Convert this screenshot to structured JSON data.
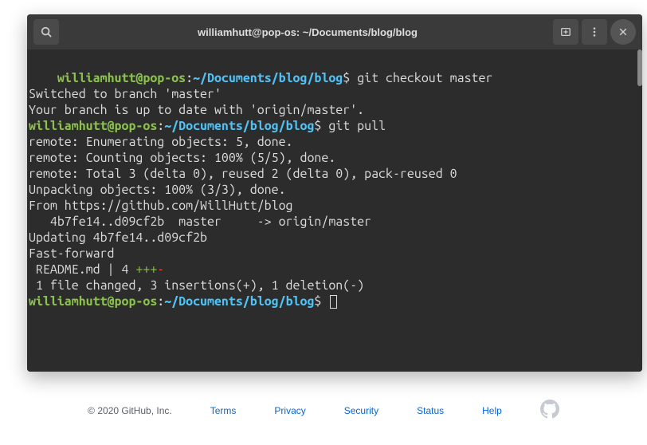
{
  "titlebar": {
    "title": "williamhutt@pop-os: ~/Documents/blog/blog"
  },
  "prompt": {
    "user": "williamhutt@pop-os",
    "colon": ":",
    "path": "~/Documents/blog/blog",
    "dollar": "$ "
  },
  "lines": {
    "cmd1": "git checkout master",
    "out1": "Switched to branch 'master'",
    "out2": "Your branch is up to date with 'origin/master'.",
    "cmd2": "git pull",
    "out3": "remote: Enumerating objects: 5, done.",
    "out4": "remote: Counting objects: 100% (5/5), done.",
    "out5": "remote: Total 3 (delta 0), reused 2 (delta 0), pack-reused 0",
    "out6": "Unpacking objects: 100% (3/3), done.",
    "out7": "From https://github.com/WillHutt/blog",
    "out8": "   4b7fe14..d09cf2b  master     -> origin/master",
    "out9": "Updating 4b7fe14..d09cf2b",
    "out10": "Fast-forward",
    "out11_pre": " README.md | 4 ",
    "out11_plus": "+++",
    "out11_minus": "-",
    "out12": " 1 file changed, 3 insertions(+), 1 deletion(-)"
  },
  "footer": {
    "copyright": "© 2020 GitHub, Inc.",
    "links": {
      "terms": "Terms",
      "privacy": "Privacy",
      "security": "Security",
      "status": "Status",
      "help": "Help"
    }
  }
}
